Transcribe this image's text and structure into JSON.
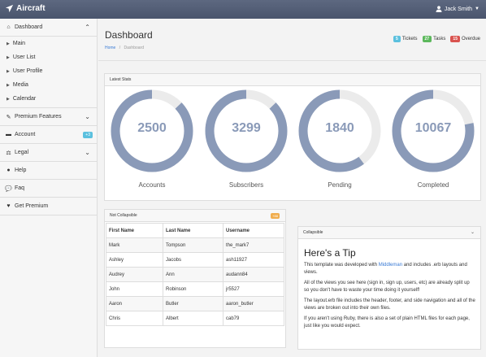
{
  "app": {
    "brand": "Aircraft",
    "user": "Jack Smith"
  },
  "sidebar": {
    "dashboard": "Dashboard",
    "sub": [
      "Main",
      "User List",
      "User Profile",
      "Media",
      "Calendar"
    ],
    "premium": "Premium Features",
    "account": "Account",
    "account_badge": "+3",
    "legal": "Legal",
    "help": "Help",
    "faq": "Faq",
    "get_premium": "Get Premium"
  },
  "header": {
    "title": "Dashboard",
    "breadcrumb_home": "Home",
    "breadcrumb_sep": "/",
    "breadcrumb_current": "Dashboard",
    "tickets_count": "5",
    "tickets_label": "Tickets",
    "tasks_count": "27",
    "tasks_label": "Tasks",
    "overdue_count": "15",
    "overdue_label": "Overdue",
    "colors": {
      "tickets": "#5bc0de",
      "tasks": "#5cb85c",
      "overdue": "#d9534f"
    }
  },
  "stats": {
    "title": "Latest Stats",
    "items": [
      {
        "value": "2500",
        "label": "Accounts",
        "fraction": 0.87
      },
      {
        "value": "3299",
        "label": "Subscribers",
        "fraction": 0.87
      },
      {
        "value": "1840",
        "label": "Pending",
        "fraction": 0.6
      },
      {
        "value": "10067",
        "label": "Completed",
        "fraction": 0.78
      }
    ],
    "colors": {
      "fill": "#8a9ab8",
      "track": "#ebebeb"
    }
  },
  "table_panel": {
    "title": "Not Collapsible",
    "badge": "+88",
    "headers": [
      "First Name",
      "Last Name",
      "Username"
    ],
    "rows": [
      [
        "Mark",
        "Tompson",
        "the_mark7"
      ],
      [
        "Ashley",
        "Jacobs",
        "ash11927"
      ],
      [
        "Audrey",
        "Ann",
        "audann84"
      ],
      [
        "John",
        "Robinson",
        "jr5527"
      ],
      [
        "Aaron",
        "Butler",
        "aaron_butler"
      ],
      [
        "Chris",
        "Albert",
        "cab79"
      ]
    ]
  },
  "tip_panel": {
    "title": "Collapsible",
    "heading": "Here's a Tip",
    "p1_before": "This template was developed with ",
    "p1_link": "Middleman",
    "p1_after": " and includes .erb layouts and views.",
    "p2": "All of the views you see here (sign in, sign up, users, etc) are already split up so you don't have to waste your time doing it yourself!",
    "p3": "The layout.erb file includes the header, footer, and side navigation and all of the views are broken out into their own files.",
    "p4": "If you aren't using Ruby, there is also a set of plain HTML files for each page, just like you would expect."
  }
}
